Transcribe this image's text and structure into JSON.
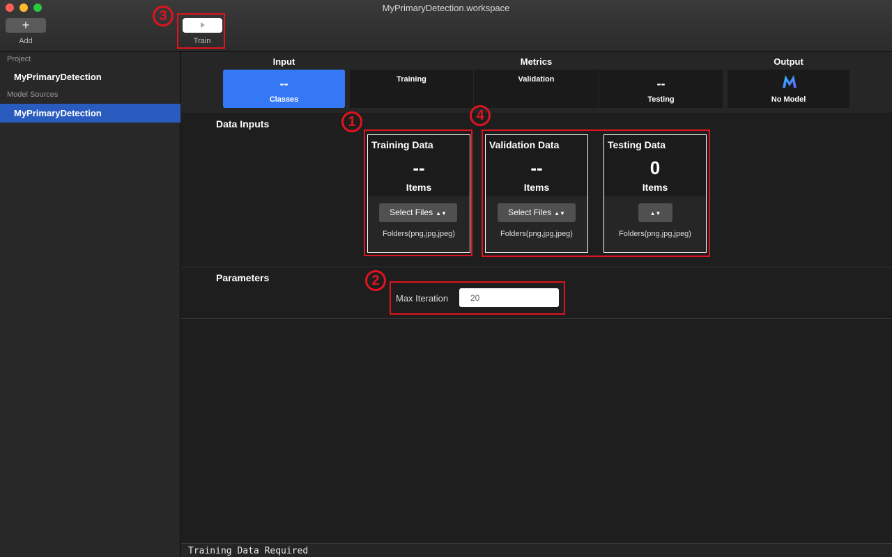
{
  "window": {
    "title": "MyPrimaryDetection.workspace"
  },
  "toolbar": {
    "add_icon": "+",
    "add_label": "Add",
    "train_label": "Train"
  },
  "sidebar": {
    "project_header": "Project",
    "project_name": "MyPrimaryDetection",
    "sources_header": "Model Sources",
    "source_item": "MyPrimaryDetection"
  },
  "tabs": {
    "input_header": "Input",
    "metrics_header": "Metrics",
    "output_header": "Output",
    "classes": {
      "value": "--",
      "label": "Classes"
    },
    "training": {
      "label": "Training"
    },
    "validation": {
      "label": "Validation"
    },
    "testing": {
      "value": "--",
      "label": "Testing"
    },
    "output": {
      "label": "No Model"
    }
  },
  "data_inputs": {
    "title": "Data Inputs",
    "training": {
      "title": "Training Data",
      "count": "--",
      "unit": "Items",
      "button": "Select Files",
      "formats": "Folders(png,jpg,jpeg)"
    },
    "validation": {
      "title": "Validation Data",
      "count": "--",
      "unit": "Items",
      "button": "Select Files",
      "formats": "Folders(png,jpg,jpeg)"
    },
    "testing": {
      "title": "Testing Data",
      "count": "0",
      "unit": "Items",
      "button": "",
      "formats": "Folders(png,jpg,jpeg)"
    }
  },
  "parameters": {
    "title": "Parameters",
    "max_iteration_label": "Max Iteration",
    "max_iteration_value": "20"
  },
  "annotations": {
    "badge1": "1",
    "badge2": "2",
    "badge3": "3",
    "badge4": "4"
  },
  "status": {
    "text": "Training Data Required"
  },
  "colors": {
    "accent": "#3478f6",
    "selected": "#2a5cbf",
    "annotation": "#e0141e"
  }
}
